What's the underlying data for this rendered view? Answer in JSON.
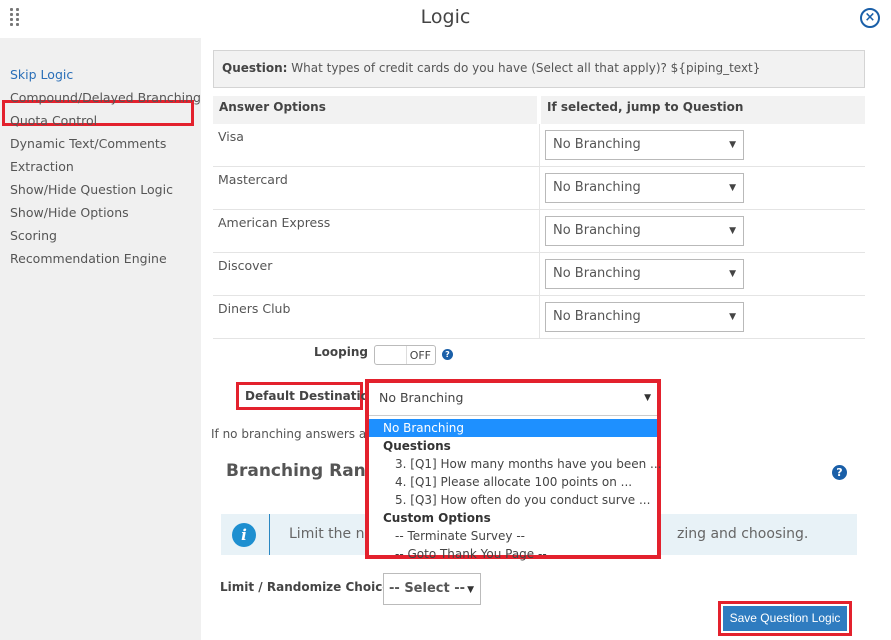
{
  "header": {
    "title": "Logic",
    "close_symbol": "×"
  },
  "sidebar": {
    "items": [
      {
        "label": "Skip Logic",
        "active": true
      },
      {
        "label": "Compound/Delayed Branching"
      },
      {
        "label": "Quota Control"
      },
      {
        "label": "Dynamic Text/Comments"
      },
      {
        "label": "Extraction"
      },
      {
        "label": "Show/Hide Question Logic"
      },
      {
        "label": "Show/Hide Options"
      },
      {
        "label": "Scoring"
      },
      {
        "label": "Recommendation Engine"
      }
    ]
  },
  "question": {
    "prefix": "Question:",
    "text": " What types of credit cards do you have (Select all that apply)? ${piping_text}"
  },
  "table": {
    "headers": [
      "Answer Options",
      "If selected, jump to Question"
    ],
    "rows": [
      {
        "option": "Visa",
        "jump": "No Branching"
      },
      {
        "option": "Mastercard",
        "jump": "No Branching"
      },
      {
        "option": "American Express",
        "jump": "No Branching"
      },
      {
        "option": "Discover",
        "jump": "No Branching"
      },
      {
        "option": "Diners Club",
        "jump": "No Branching"
      }
    ]
  },
  "looping": {
    "label": "Looping",
    "state": "OFF",
    "help": "?"
  },
  "default_destination": {
    "label": "Default Destination",
    "selected": "No Branching",
    "options": {
      "highlighted": "No Branching",
      "group_questions": "Questions",
      "questions": [
        "3. [Q1] How many months have you been ...",
        "4. [Q1] Please allocate 100 points on ...",
        "5. [Q3] How often do you conduct surve ..."
      ],
      "group_custom": "Custom Options",
      "custom": [
        "-- Terminate Survey --",
        "-- Goto Thank You Page --"
      ]
    }
  },
  "branch_note": "If no branching answers are",
  "branching_random": {
    "title": "Branching Rando",
    "help": "?"
  },
  "info": {
    "icon": "i",
    "text_left": "Limit the nu",
    "text_right": "zing and choosing."
  },
  "limit": {
    "label": "Limit / Randomize Choices to",
    "selected": "-- Select --"
  },
  "save_label": "Save Question Logic",
  "colors": {
    "accent_blue": "#2f7cc0",
    "highlight_blue": "#1e90ff",
    "annotation_red": "#e3212d"
  }
}
